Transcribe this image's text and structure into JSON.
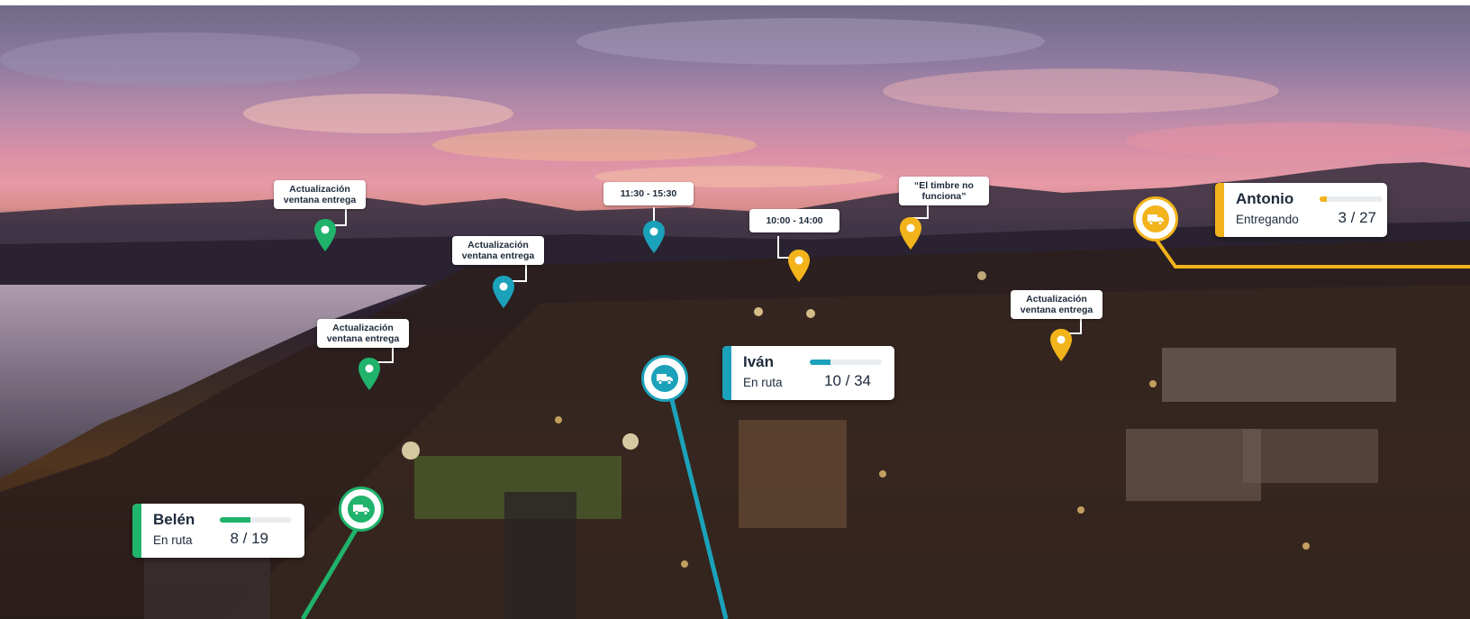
{
  "colors": {
    "green": "#1fb36b",
    "teal": "#1ba2ba",
    "yellow": "#f2b31b",
    "label_text": "#1d2a3a"
  },
  "labels": {
    "label_a": "Actualización ventana entrega",
    "label_b": "11:30 - 15:30",
    "label_c": "Actualización ventana entrega",
    "label_d": "10:00 - 14:00",
    "label_e": "“El timbre no funciona”",
    "label_f": "Actualización ventana entrega",
    "label_g": "Actualización ventana entrega"
  },
  "drivers": {
    "antonio": {
      "name": "Antonio",
      "status": "Entregando",
      "count": "3 / 27",
      "progress": 0.11,
      "color": "yellow"
    },
    "ivan": {
      "name": "Iván",
      "status": "En ruta",
      "count": "10 / 34",
      "progress": 0.29,
      "color": "teal"
    },
    "belen": {
      "name": "Belén",
      "status": "En ruta",
      "count": "8 / 19",
      "progress": 0.42,
      "color": "green"
    }
  },
  "icons": [
    "map-pin-icon",
    "truck-icon"
  ]
}
